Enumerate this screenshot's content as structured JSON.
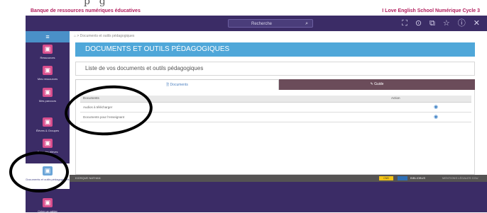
{
  "banner": {
    "left": "Banque de ressources numériques éducatives",
    "right": "I Love English School Numérique Cycle 3",
    "partial_heading": "p ' g"
  },
  "topnav": {
    "search_text": "Recherche",
    "icons": [
      "expand-icon",
      "help-icon",
      "external-icon",
      "star-icon",
      "info-icon",
      "close-icon"
    ],
    "icon_glyphs": [
      "⛶",
      "⊙",
      "⧉",
      "☆",
      "ⓘ",
      "✕"
    ]
  },
  "sidebar": {
    "menu_glyph": "≡",
    "items": [
      {
        "label": "Ressources",
        "glyph": "▣"
      },
      {
        "label": "Mes ressources",
        "glyph": "▣"
      },
      {
        "label": "Mes parcours",
        "glyph": "▣"
      },
      {
        "label": "Élèves & Groupes",
        "glyph": "▣"
      },
      {
        "label": "Suivi des élèves",
        "glyph": "▣"
      },
      {
        "label": "Documents et outils pédagogiques",
        "glyph": "▣"
      },
      {
        "label": "Créer un cahier",
        "glyph": "▣"
      }
    ]
  },
  "breadcrumb": "⌂ > Documents et outils pédagogiques",
  "page_title": "DOCUMENTS ET OUTILS PÉDAGOGIQUES",
  "subtitle": "Liste de vos documents et outils pédagogiques",
  "tabs": {
    "documents": "🗎 Documents",
    "guide": "✎ Guide"
  },
  "table": {
    "headers": [
      "Documents",
      "Action"
    ],
    "rows": [
      "Audios à télécharger",
      "Documents pour l'enseignant"
    ]
  },
  "footer": {
    "left": "KIOSQUE NATHAN",
    "badge": "CNS",
    "right_text": "BIBLIOBUS",
    "right_links": "MENTIONS LÉGALES    CGU"
  },
  "colors": {
    "brand": "#b21d5d",
    "nav": "#3b2c66",
    "title_bar": "#4fa7d9",
    "tab_active_bg": "#6b4c5a"
  }
}
